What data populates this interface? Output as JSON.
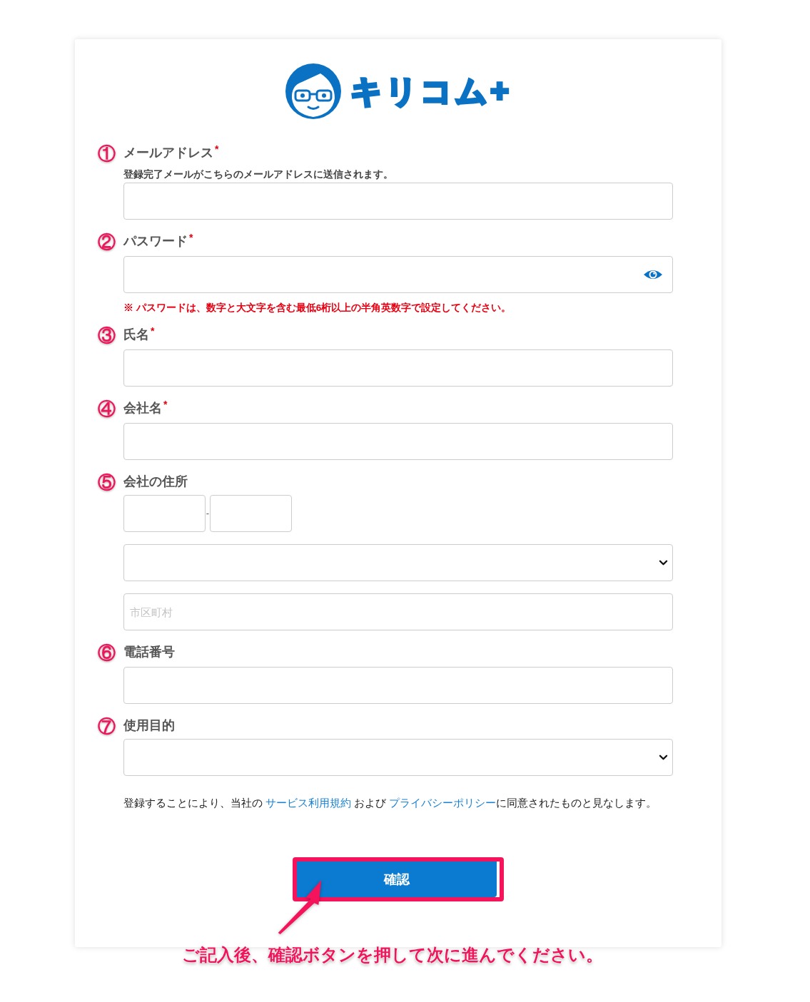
{
  "logo": {
    "text": "キリコム+"
  },
  "fields": [
    {
      "marker": "①",
      "label": "メールアドレス",
      "required_mark": "*",
      "hint": "登録完了メールがこちらのメールアドレスに送信されます。",
      "kind": "text"
    },
    {
      "marker": "②",
      "label": "パスワード",
      "required_mark": "*",
      "kind": "password",
      "note": "※ パスワードは、数字と大文字を含む最低6桁以上の半角英数字で設定してください。"
    },
    {
      "marker": "③",
      "label": "氏名",
      "required_mark": "*",
      "kind": "text"
    },
    {
      "marker": "④",
      "label": "会社名",
      "required_mark": "*",
      "kind": "text"
    },
    {
      "marker": "⑤",
      "label": "会社の住所",
      "kind": "address",
      "postal_separator": "-",
      "city_placeholder": "市区町村"
    },
    {
      "marker": "⑥",
      "label": "電話番号",
      "kind": "text"
    },
    {
      "marker": "⑦",
      "label": "使用目的",
      "kind": "select"
    }
  ],
  "consent": {
    "parts": [
      {
        "text": "登録することにより、当社の ",
        "kind": "plain"
      },
      {
        "text": "サービス利用規約",
        "kind": "link"
      },
      {
        "text": " および ",
        "kind": "plain"
      },
      {
        "text": "プライバシーポリシー",
        "kind": "link"
      },
      {
        "text": "に同意されたものと見なします。",
        "kind": "plain"
      }
    ]
  },
  "confirm_button": {
    "label": "確認"
  },
  "callout": {
    "text": "ご記入後、確認ボタンを押して次に進んでください。"
  }
}
